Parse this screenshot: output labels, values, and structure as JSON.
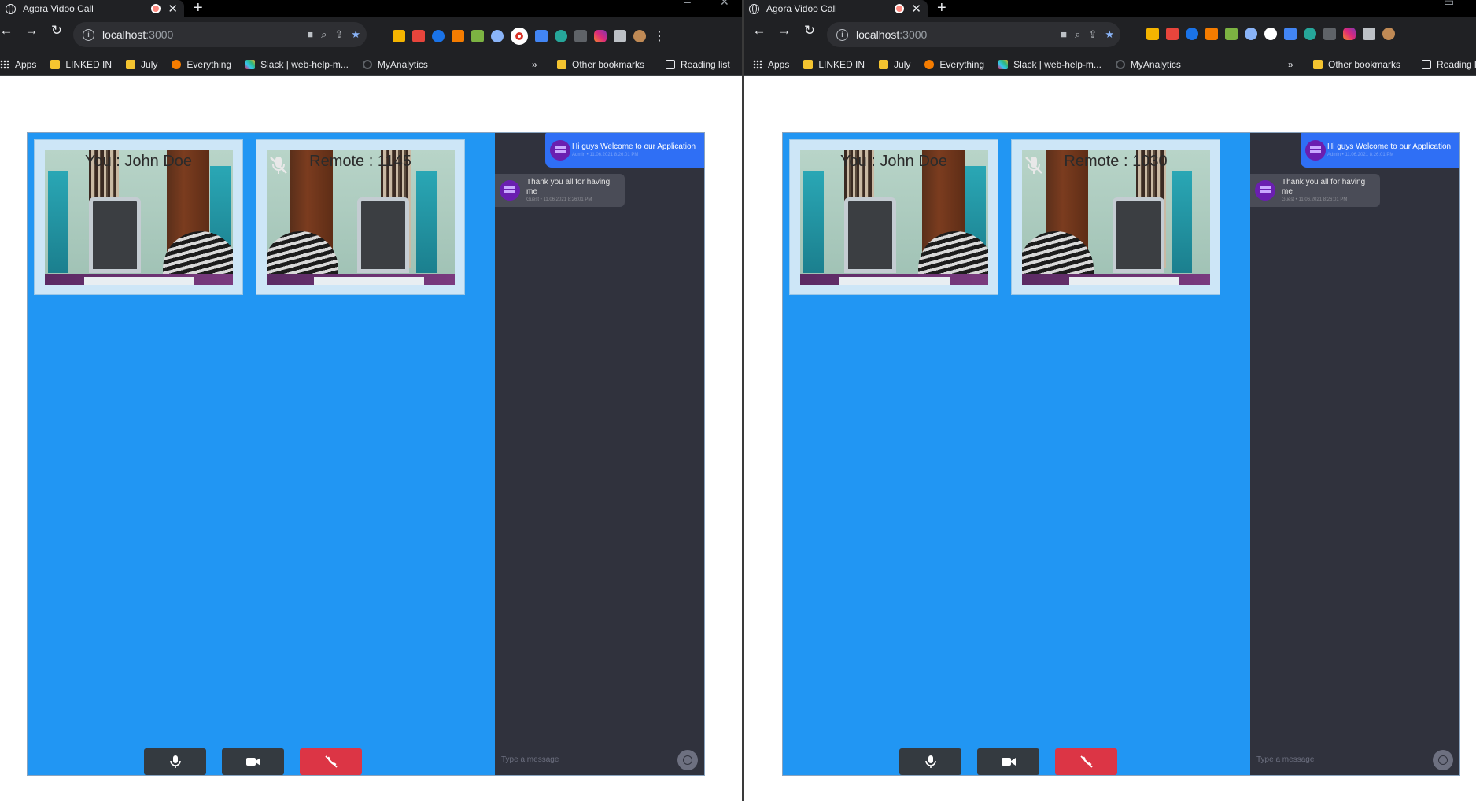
{
  "windows": [
    {
      "id": "left",
      "tab_title": "Agora Vidoo Call",
      "url_host": "localhost",
      "url_port": ":3000",
      "bookmarks": [
        "Apps",
        "LINKED IN",
        "July",
        "Everything",
        "Slack | web-help-m...",
        "MyAnalytics"
      ],
      "more_bookmarks": "»",
      "other_bookmarks": "Other bookmarks",
      "reading_list": "Reading list",
      "tiles": [
        {
          "label": "You : John Doe",
          "muted": false
        },
        {
          "label": "Remote : 1145",
          "muted": true
        }
      ],
      "messages": [
        {
          "direction": "out",
          "text": "Hi guys Welcome to our Application",
          "meta": "Admin • 11.06.2021 8:26:01 PM"
        },
        {
          "direction": "in",
          "text": "Thank you all for having me",
          "meta": "Guest • 11.06.2021 8:26:01 PM"
        }
      ],
      "composer_placeholder": "Type a message"
    },
    {
      "id": "right",
      "tab_title": "Agora Vidoo Call",
      "url_host": "localhost",
      "url_port": ":3000",
      "bookmarks": [
        "Apps",
        "LINKED IN",
        "July",
        "Everything",
        "Slack | web-help-m...",
        "MyAnalytics"
      ],
      "more_bookmarks": "»",
      "other_bookmarks": "Other bookmarks",
      "reading_list": "Reading l",
      "tiles": [
        {
          "label": "You : John Doe",
          "muted": false
        },
        {
          "label": "Remote : 1030",
          "muted": true
        }
      ],
      "messages": [
        {
          "direction": "out",
          "text": "Hi guys Welcome to our Application",
          "meta": "Admin • 11.06.2021 8:26:01 PM"
        },
        {
          "direction": "in",
          "text": "Thank you all for having me",
          "meta": "Guest • 11.06.2021 8:26:01 PM"
        }
      ],
      "composer_placeholder": "Type a message"
    }
  ],
  "colors": {
    "app_background": "#2196f3",
    "chat_background": "#30323d",
    "outgoing_bubble": "#2f6ff5",
    "incoming_bubble": "#4a4c57",
    "control_dark": "#343a40",
    "end_call_red": "#dc3545"
  },
  "icons": {
    "mic_button": "microphone-icon",
    "camera_button": "video-camera-icon",
    "end_button": "phone-hangup-icon",
    "muted_indicator": "microphone-slash-icon"
  }
}
